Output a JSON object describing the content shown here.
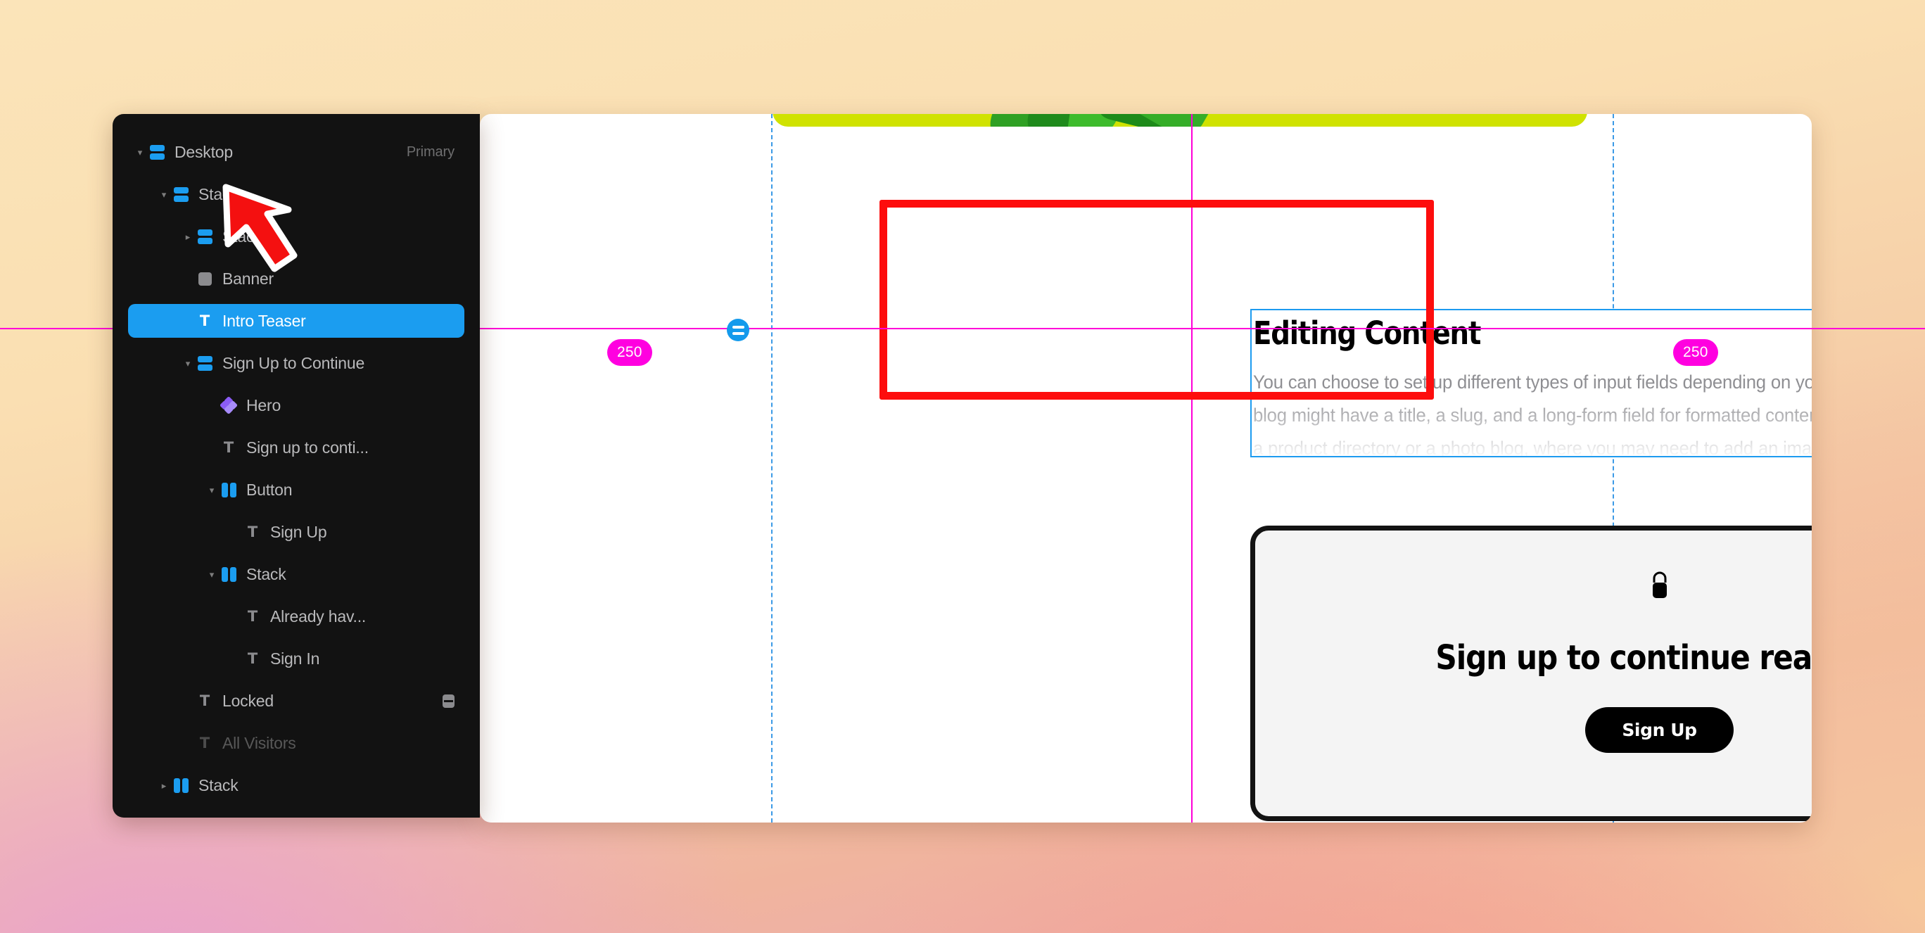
{
  "app": {
    "background_colors": [
      "#fbe4b9",
      "#f6cfa8",
      "#eaa6b8",
      "#f79e86"
    ],
    "accent": "#1b9df0",
    "selection_highlight": "#fd0d0d",
    "guide_color": "#ff00d8"
  },
  "sidebar": {
    "name": "layers-tree",
    "items": [
      {
        "label": "Desktop",
        "icon": "stack-horizontal-icon",
        "indent": 0,
        "twisty": "down",
        "tag": "Primary",
        "state": "normal"
      },
      {
        "label": "Stack",
        "icon": "stack-horizontal-icon",
        "indent": 1,
        "twisty": "down",
        "tag": "",
        "state": "normal"
      },
      {
        "label": "Stack",
        "icon": "stack-horizontal-icon",
        "indent": 2,
        "twisty": "right",
        "tag": "",
        "state": "normal"
      },
      {
        "label": "Banner",
        "icon": "rectangle-icon",
        "indent": 2,
        "twisty": "none",
        "tag": "",
        "state": "normal"
      },
      {
        "label": "Intro Teaser",
        "icon": "text-icon",
        "indent": 2,
        "twisty": "none",
        "tag": "",
        "state": "selected"
      },
      {
        "label": "Sign Up to Continue",
        "icon": "stack-horizontal-icon",
        "indent": 2,
        "twisty": "down",
        "tag": "",
        "state": "normal"
      },
      {
        "label": "Hero",
        "icon": "component-icon",
        "indent": 3,
        "twisty": "none",
        "tag": "",
        "state": "normal"
      },
      {
        "label": "Sign up to conti...",
        "icon": "text-icon",
        "indent": 3,
        "twisty": "none",
        "tag": "",
        "state": "normal"
      },
      {
        "label": "Button",
        "icon": "stack-vertical-icon",
        "indent": 3,
        "twisty": "down",
        "tag": "",
        "state": "normal"
      },
      {
        "label": "Sign Up",
        "icon": "text-icon",
        "indent": 4,
        "twisty": "none",
        "tag": "",
        "state": "normal"
      },
      {
        "label": "Stack",
        "icon": "stack-vertical-icon",
        "indent": 3,
        "twisty": "down",
        "tag": "",
        "state": "normal"
      },
      {
        "label": "Already hav...",
        "icon": "text-icon",
        "indent": 4,
        "twisty": "none",
        "tag": "",
        "state": "normal"
      },
      {
        "label": "Sign In",
        "icon": "text-icon",
        "indent": 4,
        "twisty": "none",
        "tag": "",
        "state": "normal"
      },
      {
        "label": "Locked",
        "icon": "text-icon",
        "indent": 2,
        "twisty": "none",
        "tag": "",
        "state": "normal",
        "badge": "variant-icon"
      },
      {
        "label": "All Visitors",
        "icon": "text-icon",
        "indent": 2,
        "twisty": "none",
        "tag": "",
        "state": "dimmed"
      },
      {
        "label": "Stack",
        "icon": "stack-vertical-icon",
        "indent": 1,
        "twisty": "right",
        "tag": "",
        "state": "normal"
      }
    ]
  },
  "canvas": {
    "teaser": {
      "heading": "Editing Content",
      "body": "You can choose to set up different types of input fields depending on your content. For instance, a blog might have a title, a slug, and a long-form field for formatted content. These may be different for a product directory or a photo blog, where you may need to add an image field. To edit the fields each CMS item will have, click on any of the column titles. This will trigger a modal to add new fields, where you can also re-arrange the fields or modify or delete the existing ones."
    },
    "lock_card": {
      "icon": "lock-icon",
      "title": "Sign up to continue reading",
      "button_label": "Sign Up"
    },
    "spacing": {
      "left_value": "250",
      "right_value": "250"
    },
    "handle": "stack-distribute-handle"
  }
}
